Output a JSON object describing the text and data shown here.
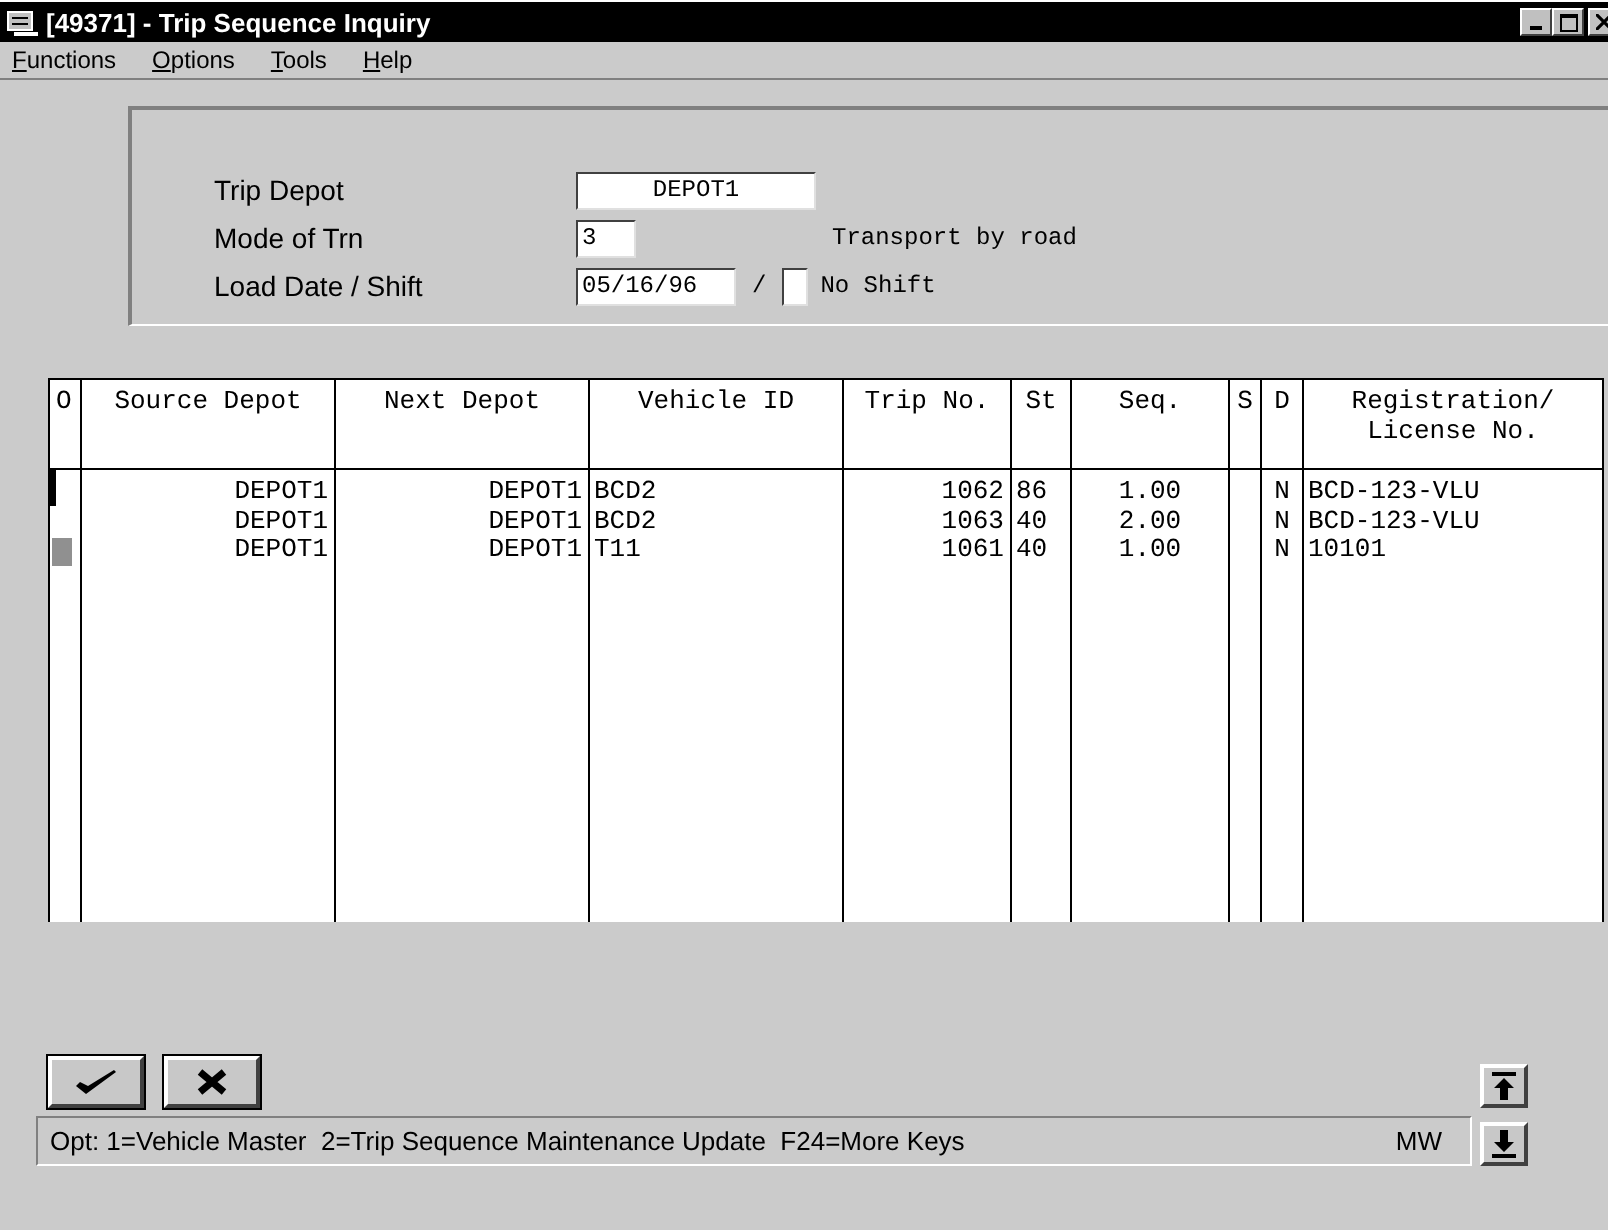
{
  "window": {
    "title": "[49371] - Trip Sequence Inquiry"
  },
  "menu": [
    {
      "label": "Functions"
    },
    {
      "label": "Options"
    },
    {
      "label": "Tools"
    },
    {
      "label": "Help"
    }
  ],
  "form": {
    "fields": [
      {
        "kind": "text",
        "label": "Trip Depot",
        "value": "DEPOT1"
      },
      {
        "kind": "code",
        "label": "Mode of Trn",
        "value": "3",
        "description": "Transport by road"
      },
      {
        "kind": "date_shift",
        "label": "Load Date / Shift",
        "value": "05/16/96",
        "separator": "/",
        "description": "No Shift"
      }
    ]
  },
  "table": {
    "columns": [
      "O",
      "Source Depot",
      "Next Depot",
      "Vehicle ID",
      "Trip No.",
      "St",
      "Seq.",
      "S",
      "D",
      "Registration/ License No."
    ],
    "rows": [
      {
        "source": "DEPOT1",
        "next": "DEPOT1",
        "vehicle": "BCD2",
        "trip": "1062",
        "st": "86",
        "seq": "1.00",
        "d": "N",
        "registration": "BCD-123-VLU",
        "cursor": true,
        "selected": false
      },
      {
        "source": "DEPOT1",
        "next": "DEPOT1",
        "vehicle": "BCD2",
        "trip": "1063",
        "st": "40",
        "seq": "2.00",
        "d": "N",
        "registration": "BCD-123-VLU",
        "cursor": false,
        "selected": false
      },
      {
        "source": "DEPOT1",
        "next": "DEPOT1",
        "vehicle": "T11",
        "trip": "1061",
        "st": "40",
        "seq": "1.00",
        "d": "N",
        "registration": "10101",
        "cursor": false,
        "selected": true
      }
    ]
  },
  "status_bar": {
    "text": "Opt: 1=Vehicle Master  2=Trip Sequence Maintenance Update  F24=More Keys",
    "mode": "MW"
  }
}
